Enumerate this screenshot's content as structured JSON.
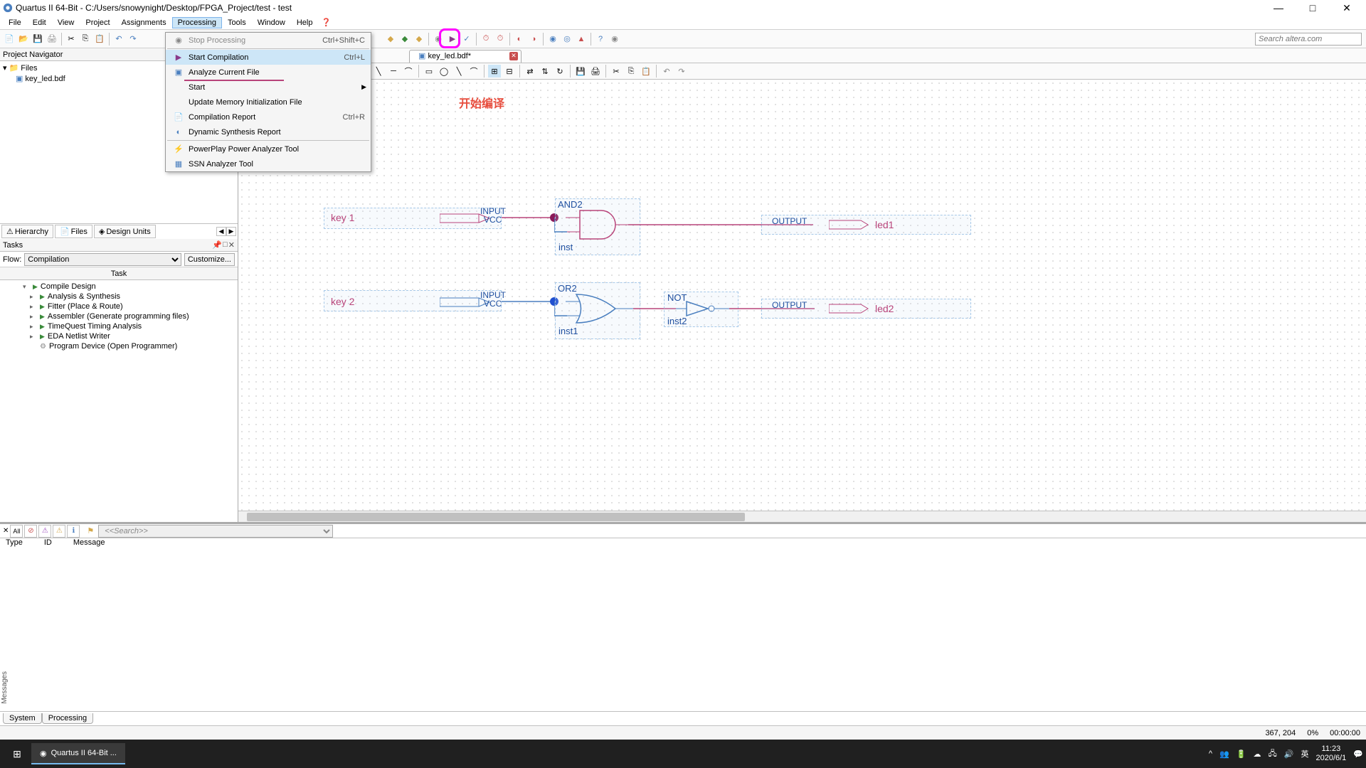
{
  "titlebar": {
    "text": "Quartus II 64-Bit - C:/Users/snowynight/Desktop/FPGA_Project/test - test"
  },
  "menubar": {
    "items": [
      "File",
      "Edit",
      "View",
      "Project",
      "Assignments",
      "Processing",
      "Tools",
      "Window",
      "Help"
    ],
    "active_index": 5
  },
  "toolbar": {
    "search_placeholder": "Search altera.com"
  },
  "dropdown": {
    "items": [
      {
        "icon": "stop",
        "label": "Stop Processing",
        "shortcut": "Ctrl+Shift+C",
        "disabled": true
      },
      {
        "sep": true
      },
      {
        "icon": "play",
        "label": "Start Compilation",
        "shortcut": "Ctrl+L",
        "highlighted": true
      },
      {
        "icon": "analyze",
        "label": "Analyze Current File",
        "shortcut": ""
      },
      {
        "icon": "",
        "label": "Start",
        "shortcut": "",
        "submenu": true
      },
      {
        "icon": "",
        "label": "Update Memory Initialization File",
        "shortcut": ""
      },
      {
        "icon": "report",
        "label": "Compilation Report",
        "shortcut": "Ctrl+R"
      },
      {
        "icon": "dyn",
        "label": "Dynamic Synthesis Report",
        "shortcut": ""
      },
      {
        "sep": true
      },
      {
        "icon": "power",
        "label": "PowerPlay Power Analyzer Tool",
        "shortcut": ""
      },
      {
        "icon": "ssn",
        "label": "SSN Analyzer Tool",
        "shortcut": ""
      }
    ]
  },
  "project_nav": {
    "header": "Project Navigator",
    "root": "Files",
    "file": "key_led.bdf",
    "tabs": [
      "Hierarchy",
      "Files",
      "Design Units"
    ],
    "active_tab": 1
  },
  "tasks": {
    "header": "Tasks",
    "flow_label": "Flow:",
    "flow_value": "Compilation",
    "customize": "Customize...",
    "task_col": "Task",
    "items": [
      {
        "label": "Compile Design",
        "root": true
      },
      {
        "label": "Analysis & Synthesis"
      },
      {
        "label": "Fitter (Place & Route)"
      },
      {
        "label": "Assembler (Generate programming files)"
      },
      {
        "label": "TimeQuest Timing Analysis"
      },
      {
        "label": "EDA Netlist Writer"
      },
      {
        "label": "Program Device (Open Programmer)",
        "gear": true
      }
    ]
  },
  "editor": {
    "tab_name": "key_led.bdf*",
    "annotation": "开始编译"
  },
  "schematic": {
    "key1": "key 1",
    "key2": "key 2",
    "input": "INPUT",
    "vcc": "VCC",
    "and2": "AND2",
    "or2": "OR2",
    "not": "NOT",
    "output": "OUTPUT",
    "inst": "inst",
    "inst1": "inst1",
    "inst2": "inst2",
    "led1": "led1",
    "led2": "led2"
  },
  "messages": {
    "all": "All",
    "search_placeholder": "<<Search>>",
    "cols": [
      "Type",
      "ID",
      "Message"
    ],
    "vert": "Messages",
    "tabs": [
      "System",
      "Processing"
    ]
  },
  "statusbar": {
    "coords": "367, 204",
    "pct": "0%",
    "time": "00:00:00"
  },
  "taskbar": {
    "app": "Quartus II 64-Bit ...",
    "ime": "英",
    "time": "11:23",
    "date": "2020/6/1"
  }
}
